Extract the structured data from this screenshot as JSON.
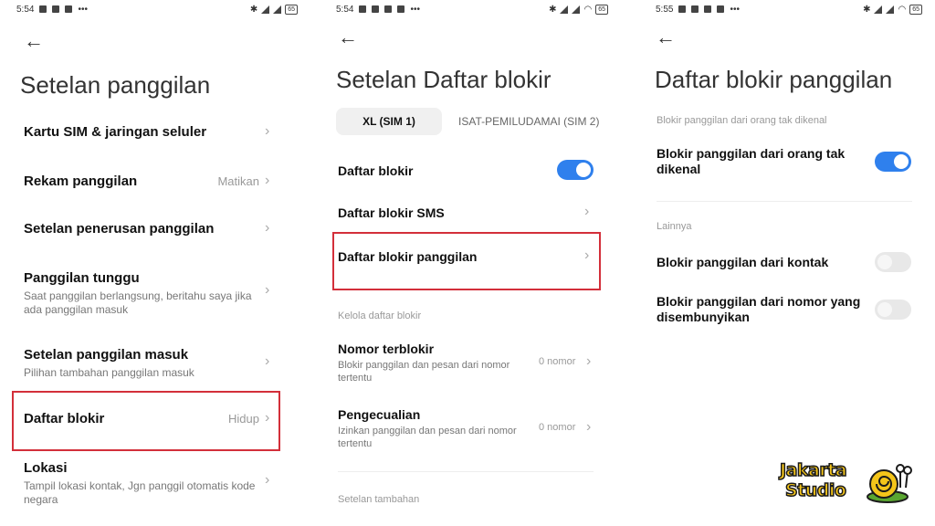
{
  "panel1": {
    "status": {
      "time": "5:54",
      "battery": "65"
    },
    "title": "Setelan panggilan",
    "rows": [
      {
        "title": "Kartu SIM & jaringan seluler"
      },
      {
        "title": "Rekam panggilan",
        "value": "Matikan"
      },
      {
        "title": "Setelan penerusan panggilan"
      },
      {
        "title": "Panggilan tunggu",
        "subtitle": "Saat panggilan berlangsung, beritahu saya jika ada panggilan masuk"
      },
      {
        "title": "Setelan panggilan masuk",
        "subtitle": "Pilihan tambahan panggilan masuk"
      },
      {
        "title": "Daftar blokir",
        "value": "Hidup"
      },
      {
        "title": "Lokasi",
        "subtitle": "Tampil lokasi kontak, Jgn panggil otomatis kode negara"
      }
    ]
  },
  "panel2": {
    "status": {
      "time": "5:54",
      "battery": "65"
    },
    "title": "Setelan Daftar blokir",
    "tabs": [
      "XL (SIM 1)",
      "ISAT-PEMILUDAMAI (SIM 2)"
    ],
    "rows": [
      {
        "title": "Daftar blokir",
        "toggle": true
      },
      {
        "title": "Daftar blokir SMS"
      },
      {
        "title": "Daftar blokir panggilan"
      }
    ],
    "section_manage": "Kelola daftar blokir",
    "manage_rows": [
      {
        "title": "Nomor terblokir",
        "subtitle": "Blokir panggilan dan pesan dari nomor tertentu",
        "value": "0 nomor"
      },
      {
        "title": "Pengecualian",
        "subtitle": "Izinkan panggilan dan pesan dari nomor tertentu",
        "value": "0 nomor"
      }
    ],
    "section_extra": "Setelan tambahan"
  },
  "panel3": {
    "status": {
      "time": "5:55",
      "battery": "65"
    },
    "title": "Daftar blokir panggilan",
    "section_unknown": "Blokir panggilan dari orang tak dikenal",
    "row_unknown": {
      "title": "Blokir panggilan dari orang tak dikenal",
      "toggle": true
    },
    "section_other": "Lainnya",
    "row_contacts": {
      "title": "Blokir panggilan dari kontak",
      "toggle": false
    },
    "row_hidden": {
      "title": "Blokir panggilan dari nomor yang disembunyikan",
      "toggle": false
    }
  },
  "logo": {
    "line1": "Jakarta",
    "line2": "Studio"
  },
  "colors": {
    "accent": "#2f80ed",
    "highlight": "#d32f3a",
    "logo_yellow": "#f4c51a"
  }
}
